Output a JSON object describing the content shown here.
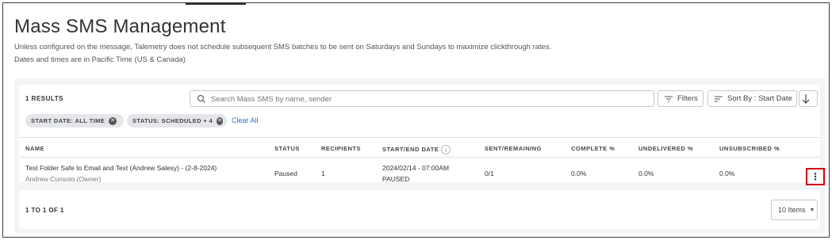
{
  "page": {
    "title": "Mass SMS Management",
    "description_line1": "Unless configured on the message, Talemetry does not schedule subsequent SMS batches to be sent on Saturdays and Sundays to maximize clickthrough rates.",
    "description_line2": "Dates and times are in Pacific Time (US & Canada)"
  },
  "toolbar": {
    "results_label": "1 RESULTS",
    "search_placeholder": "Search Mass SMS by name, sender",
    "filters_label": "Filters",
    "sort_label": "Sort By : Start Date"
  },
  "chips": [
    {
      "label": "START DATE: ALL TIME"
    },
    {
      "label": "STATUS: SCHEDULED + 4"
    }
  ],
  "clear_all": "Clear All",
  "table": {
    "headers": [
      "NAME",
      "STATUS",
      "RECIPIENTS",
      "START/END DATE",
      "SENT/REMAINING",
      "COMPLETE %",
      "UNDELIVERED %",
      "UNSUBSCRIBED %"
    ],
    "rows": [
      {
        "name": "Test Folder Safe to Email and Text (Andrew Salesy) - (2-8-2024)",
        "owner": "Andrew Cunsolo (Owner)",
        "status": "Paused",
        "recipients": "1",
        "start_date": "2024/02/14 - 07:00AM",
        "end_state": "PAUSED",
        "sent_remaining": "0/1",
        "complete": "0.0%",
        "undelivered": "0.0%",
        "unsubscribed": "0.0%"
      }
    ]
  },
  "pagination": {
    "range_label": "1 TO 1 OF 1",
    "page_size": "10 Items"
  },
  "colors": {
    "link": "#2f6fd6",
    "highlight_border": "#d10000"
  },
  "icons": {
    "search": "search-icon",
    "filters": "filter-icon",
    "sort": "sort-icon",
    "sort_direction": "arrow-down-icon",
    "row_actions": "kebab-menu-icon"
  }
}
